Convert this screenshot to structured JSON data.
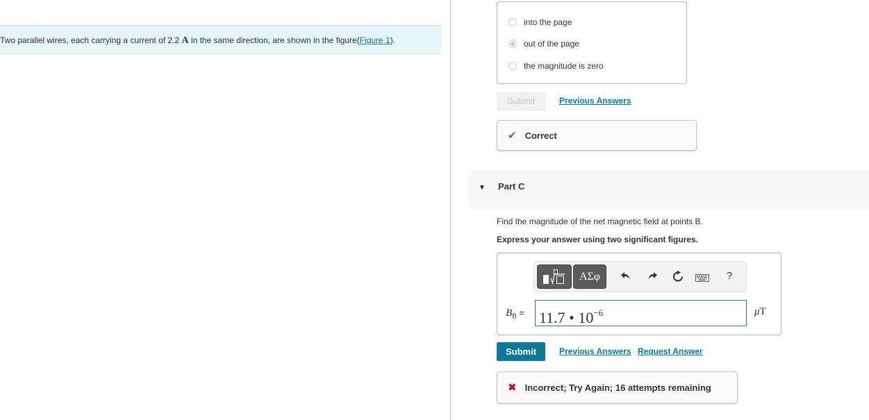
{
  "intro": {
    "text_before": "Two parallel wires, each carrying a current of 2.2 ",
    "unit": "A",
    "text_after": " in the same direction, are shown in the figure(",
    "figure_link": "Figure 1",
    "text_end": ")."
  },
  "part_b": {
    "choices": [
      {
        "label": "into the page",
        "selected": false
      },
      {
        "label": "out of the page",
        "selected": true
      },
      {
        "label": "the magnitude is zero",
        "selected": false
      }
    ],
    "submit_label": "Submit",
    "previous_answers_label": "Previous Answers",
    "feedback": "Correct",
    "feedback_icon": "checkmark-icon"
  },
  "part_c": {
    "toggle_icon": "▼",
    "title": "Part C",
    "question": "Find the magnitude of the net magnetic field at points B.",
    "instruction": "Express your answer using two significant figures.",
    "toolbar": {
      "templates_label": "templates",
      "greek_label": "ΑΣφ",
      "undo_icon": "↶",
      "redo_icon": "↷",
      "reset_icon": "↻",
      "keyboard_icon": "⌨",
      "help_label": "?"
    },
    "variable": "B",
    "variable_sub": "B",
    "equals": "=",
    "answer_base": "11.7 • 10",
    "answer_exponent": "−6",
    "unit_prefix": "μ",
    "unit": "T",
    "submit_label": "Submit",
    "previous_answers_label": "Previous Answers",
    "request_answer_label": "Request Answer",
    "feedback": "Incorrect; Try Again; 16 attempts remaining",
    "feedback_icon": "cross-icon"
  },
  "colors": {
    "accent": "#0e7a9a",
    "link": "#007f9f",
    "correct": "#2e8b3a",
    "incorrect": "#d0021b",
    "intro_bg": "#e5f4f6"
  }
}
